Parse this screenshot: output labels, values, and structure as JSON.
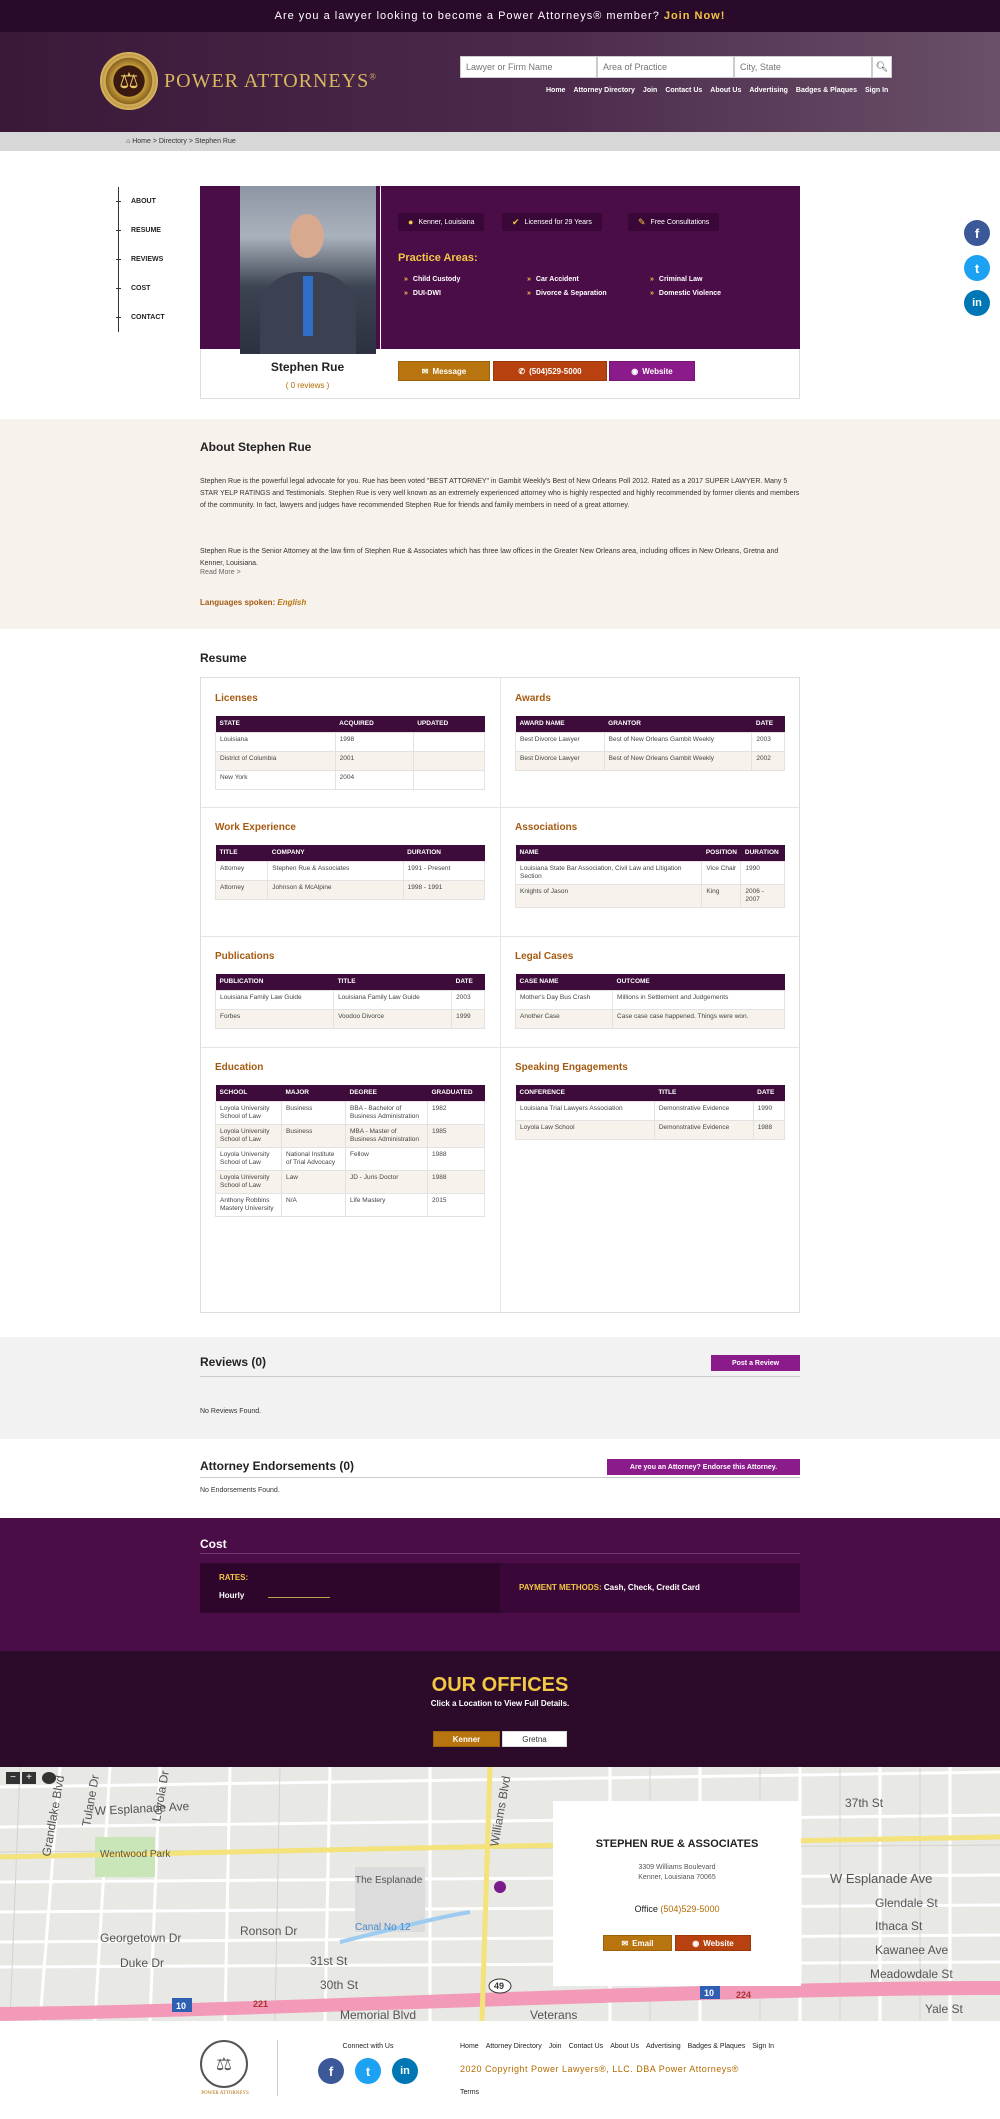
{
  "topbar": {
    "text": "Are you a lawyer looking to become a Power Attorneys® member?",
    "join": "Join Now!"
  },
  "logo": {
    "text": "POWER ATTORNEYS",
    "mark": "®"
  },
  "search": {
    "name_placeholder": "Lawyer or Firm Name",
    "area_placeholder": "Area of Practice",
    "city_placeholder": "City, State"
  },
  "nav": [
    "Home",
    "Attorney Directory",
    "Join",
    "Contact Us",
    "About Us",
    "Advertising",
    "Badges & Plaques",
    "Sign In"
  ],
  "breadcrumb": {
    "home": "Home",
    "sep": ">",
    "directory": "Directory",
    "current": "Stephen Rue"
  },
  "sidenav": [
    "ABOUT",
    "RESUME",
    "REVIEWS",
    "COST",
    "CONTACT"
  ],
  "profile": {
    "name": "Stephen Rue",
    "reviews": "( 0 reviews )",
    "location": "Kenner, Louisiana",
    "licensed": "Licensed for 29 Years",
    "consult": "Free Consultations",
    "practice_title": "Practice Areas:",
    "practice_areas": [
      "Child Custody",
      "Car Accident",
      "Criminal Law",
      "DUI-DWI",
      "Divorce & Separation",
      "Domestic Violence"
    ],
    "message": "Message",
    "phone": "(504)529-5000",
    "website": "Website"
  },
  "about": {
    "title": "About Stephen Rue",
    "p1": "Stephen Rue is the powerful legal advocate for you. Rue has been voted \"BEST ATTORNEY\" in Gambit Weekly's Best of New Orleans Poll 2012. Rated as a 2017 SUPER LAWYER. Many 5 STAR YELP RATINGS and Testimonials. Stephen Rue is very well known as an extremely experienced attorney who is highly respected and highly recommended by former clients and members of the community. In fact, lawyers and judges have recommended Stephen Rue for friends and family members in need of a great attorney.",
    "p2": "Stephen Rue is the Senior Attorney at the law firm of Stephen Rue & Associates which has three law offices in the Greater New Orleans area, including offices in New Orleans, Gretna and Kenner, Louisiana.",
    "more": "Read More >",
    "lang_label": "Languages spoken:",
    "lang": "English"
  },
  "resume": {
    "title": "Resume",
    "licenses": {
      "title": "Licenses",
      "headers": [
        "STATE",
        "ACQUIRED",
        "UPDATED"
      ],
      "rows": [
        [
          "Louisiana",
          "1998",
          ""
        ],
        [
          "District of Columbia",
          "2001",
          ""
        ],
        [
          "New York",
          "2004",
          ""
        ]
      ]
    },
    "awards": {
      "title": "Awards",
      "headers": [
        "AWARD NAME",
        "GRANTOR",
        "DATE"
      ],
      "rows": [
        [
          "Best Divorce Lawyer",
          "Best of New Orleans Gambit Weekly",
          "2003"
        ],
        [
          "Best Divorce Lawyer",
          "Best of New Orleans Gambit Weekly",
          "2002"
        ]
      ]
    },
    "work": {
      "title": "Work Experience",
      "headers": [
        "TITLE",
        "COMPANY",
        "DURATION"
      ],
      "rows": [
        [
          "Attorney",
          "Stephen Rue & Associates",
          "1991 - Present"
        ],
        [
          "Attorney",
          "Johnson & McAlpine",
          "1998 - 1991"
        ]
      ]
    },
    "assoc": {
      "title": "Associations",
      "headers": [
        "NAME",
        "POSITION",
        "DURATION"
      ],
      "rows": [
        [
          "Louisiana State Bar Association, Civil Law and Litigation Section",
          "Vice Chair",
          "1990"
        ],
        [
          "Knights of Jason",
          "King",
          "2006 - 2007"
        ]
      ]
    },
    "pubs": {
      "title": "Publications",
      "headers": [
        "PUBLICATION",
        "TITLE",
        "DATE"
      ],
      "rows": [
        [
          "Louisiana Family Law Guide",
          "Louisiana Family Law Guide",
          "2003"
        ],
        [
          "Forbes",
          "Voodoo Divorce",
          "1999"
        ]
      ]
    },
    "cases": {
      "title": "Legal Cases",
      "headers": [
        "CASE NAME",
        "OUTCOME"
      ],
      "rows": [
        [
          "Mother's Day Bus Crash",
          "Millions in Settlement and Judgements"
        ],
        [
          "Another Case",
          "Case case case happened. Things were won."
        ]
      ]
    },
    "edu": {
      "title": "Education",
      "headers": [
        "SCHOOL",
        "MAJOR",
        "DEGREE",
        "GRADUATED"
      ],
      "rows": [
        [
          "Loyola University School of Law",
          "Business",
          "BBA - Bachelor of Business Administration",
          "1982"
        ],
        [
          "Loyola University School of Law",
          "Business",
          "MBA - Master of Business Administration",
          "1985"
        ],
        [
          "Loyola University School of Law",
          "National Institute of Trial Advocacy",
          "Fellow",
          "1988"
        ],
        [
          "Loyola University School of Law",
          "Law",
          "JD - Juris Doctor",
          "1988"
        ],
        [
          "Anthony Robbins Mastery University",
          "N/A",
          "Life Mastery",
          "2015"
        ]
      ]
    },
    "speak": {
      "title": "Speaking Engagements",
      "headers": [
        "CONFERENCE",
        "TITLE",
        "DATE"
      ],
      "rows": [
        [
          "Louisiana Trial Lawyers Association",
          "Demonstrative Evidence",
          "1990"
        ],
        [
          "Loyola Law School",
          "Demonstrative Evidence",
          "1988"
        ]
      ]
    }
  },
  "reviews": {
    "title": "Reviews (0)",
    "post": "Post a Review",
    "none": "No Reviews Found."
  },
  "endorse": {
    "title": "Attorney Endorsements (0)",
    "btn": "Are you an Attorney? Endorse this Attorney.",
    "none": "No Endorsements Found."
  },
  "cost": {
    "title": "Cost",
    "rates": "RATES:",
    "hourly": "Hourly",
    "payment_label": "PAYMENT METHODS:",
    "payment": "Cash, Check, Credit Card"
  },
  "offices": {
    "title": "OUR OFFICES",
    "subtitle": "Click a Location to View Full Details.",
    "tabs": [
      "Kenner",
      "Gretna"
    ]
  },
  "map": {
    "firm": "STEPHEN RUE & ASSOCIATES",
    "addr1": "3309 Williams Boulevard",
    "addr2": "Kenner, Louisiana 70065",
    "office_label": "Office",
    "office_phone": "(504)529-5000",
    "email": "Email",
    "website": "Website",
    "zoom_in": "+",
    "zoom_out": "−",
    "labels": {
      "esplanade": "W Esplanade Ave",
      "esplanade2": "W Esplanade Ave",
      "wentwood": "Wentwood Park",
      "esplanade_mall": "The Esplanade",
      "canal": "Canal No 12",
      "georgetown": "Georgetown Dr",
      "ronson": "Ronson Dr",
      "duke": "Duke Dr",
      "st31": "31st St",
      "st30": "30th St",
      "memorial": "Memorial Blvd",
      "veterans": "Veterans",
      "williams": "Williams Blvd",
      "tulane": "Tulane Dr",
      "loyola": "Loyola Dr",
      "grandlake": "Grandlake Blvd",
      "glendale": "Glendale St",
      "ithaca": "Ithaca St",
      "kawanee": "Kawanee Ave",
      "meadowdale": "Meadowdale St",
      "yale": "Yale St",
      "st37": "37th St",
      "i10": "10",
      "r49": "49",
      "r221": "221",
      "r224": "224"
    }
  },
  "footer": {
    "brand": "POWER ATTORNEYS",
    "connect": "Connect with Us",
    "nav": [
      "Home",
      "Attorney Directory",
      "Join",
      "Contact Us",
      "About Us",
      "Advertising",
      "Badges & Plaques",
      "Sign In"
    ],
    "copyright": "2020 Copyright Power Lawyers®, LLC. DBA Power Attorneys®",
    "terms": "Terms"
  }
}
